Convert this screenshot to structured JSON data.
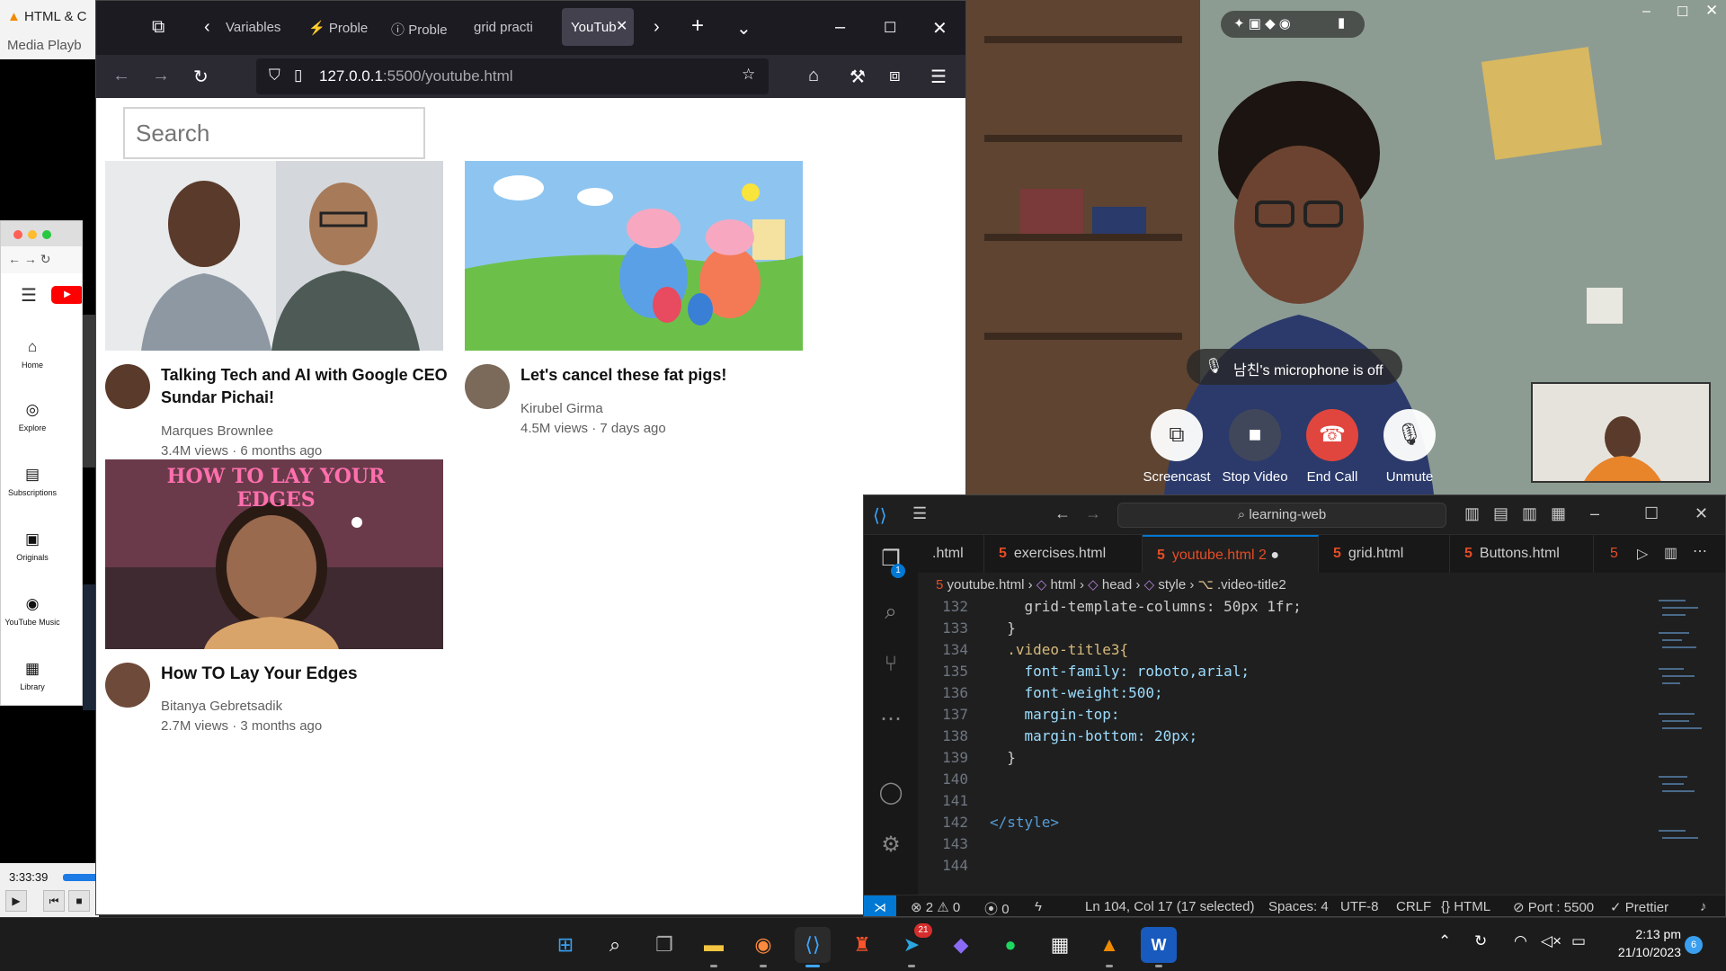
{
  "vlc": {
    "title": "HTML & C",
    "menu": "Media  Playb",
    "time": "3:33:39"
  },
  "yt_mini": {
    "nav_items": [
      "Home",
      "Explore",
      "Subscriptions",
      "Originals",
      "YouTube Music",
      "Library"
    ]
  },
  "firefox": {
    "tabs": [
      "Variables",
      "Proble",
      "Proble",
      "grid practi",
      "YouTub"
    ],
    "url_host": "127.0.0.1",
    "url_path": ":5500/youtube.html",
    "accent": "#42414d"
  },
  "youtube_page": {
    "search_placeholder": "Search",
    "videos": [
      {
        "title": "Talking Tech and AI with Google CEO Sundar Pichai!",
        "author": "Marques Brownlee",
        "stats": "3.4M views · 6 months ago"
      },
      {
        "title": "Let's cancel these fat pigs!",
        "author": "Kirubel Girma",
        "stats": "4.5M views · 7 days ago"
      },
      {
        "title": "How TO Lay Your Edges",
        "author": "Bitanya Gebretsadik",
        "stats": "2.7M views · 3 months ago",
        "thumb_text": "HOW TO LAY YOUR EDGES"
      }
    ]
  },
  "call": {
    "mic_banner": "남친's microphone is off",
    "buttons": [
      "Screencast",
      "Stop Video",
      "End Call",
      "Unmute"
    ],
    "end_call_color": "#e0463e"
  },
  "vscode": {
    "command_center": "learning-web",
    "tabs": [
      ".html",
      "exercises.html",
      "youtube.html",
      "grid.html",
      "Buttons.html"
    ],
    "active_tab_badge": "2",
    "explorer_badge": "1",
    "breadcrumb": [
      "youtube.html",
      "html",
      "head",
      "style",
      ".video-title2"
    ],
    "lines": [
      {
        "n": "132",
        "code": "    grid-template-columns: 50px 1fr;"
      },
      {
        "n": "133",
        "code": "  }"
      },
      {
        "n": "134",
        "code": "  .video-title3{"
      },
      {
        "n": "135",
        "code": "    font-family: roboto,arial;"
      },
      {
        "n": "136",
        "code": "    font-weight:500;"
      },
      {
        "n": "137",
        "code": "    margin-top:"
      },
      {
        "n": "138",
        "code": "    margin-bottom: 20px;"
      },
      {
        "n": "139",
        "code": "  }"
      },
      {
        "n": "140",
        "code": ""
      },
      {
        "n": "141",
        "code": ""
      },
      {
        "n": "142",
        "code": "</style>"
      },
      {
        "n": "143",
        "code": ""
      },
      {
        "n": "144",
        "code": ""
      }
    ],
    "status": {
      "errors": "2",
      "warnings": "0",
      "ports": "0",
      "position": "Ln 104, Col 17 (17 selected)",
      "spaces": "Spaces: 4",
      "encoding": "UTF-8",
      "eol": "CRLF",
      "language": "HTML",
      "port": "Port : 5500",
      "formatter": "Prettier"
    }
  },
  "taskbar": {
    "time": "2:13 pm",
    "date": "21/10/2023",
    "telegram_badge": "21",
    "notification_badge": "6"
  }
}
